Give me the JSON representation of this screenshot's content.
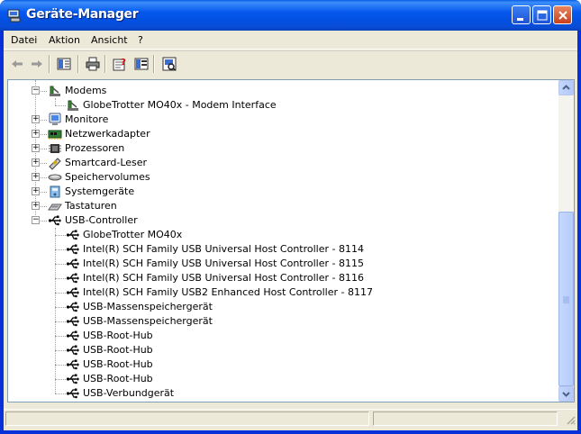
{
  "window": {
    "title": "Geräte-Manager",
    "titlebar_color": "#0558ee",
    "close_color": "#c8401c"
  },
  "menubar": {
    "items": [
      "Datei",
      "Aktion",
      "Ansicht",
      "?"
    ]
  },
  "toolbar": {
    "buttons": [
      "back-arrow-icon",
      "forward-arrow-icon",
      "console-tree-icon",
      "print-icon",
      "properties-icon",
      "view-icon",
      "scan-hardware-icon"
    ]
  },
  "tree": {
    "rows": [
      {
        "label": "Modems",
        "level": 0,
        "expanded": true,
        "icon": "modem-icon"
      },
      {
        "label": "GlobeTrotter MO40x - Modem Interface",
        "level": 1,
        "icon": "modem-icon"
      },
      {
        "label": "Monitore",
        "level": 0,
        "expanded": false,
        "icon": "monitor-icon"
      },
      {
        "label": "Netzwerkadapter",
        "level": 0,
        "expanded": false,
        "icon": "network-adapter-icon"
      },
      {
        "label": "Prozessoren",
        "level": 0,
        "expanded": false,
        "icon": "processor-icon"
      },
      {
        "label": "Smartcard-Leser",
        "level": 0,
        "expanded": false,
        "icon": "smartcard-reader-icon"
      },
      {
        "label": "Speichervolumes",
        "level": 0,
        "expanded": false,
        "icon": "storage-volume-icon"
      },
      {
        "label": "Systemgeräte",
        "level": 0,
        "expanded": false,
        "icon": "system-device-icon"
      },
      {
        "label": "Tastaturen",
        "level": 0,
        "expanded": false,
        "icon": "keyboard-icon"
      },
      {
        "label": "USB-Controller",
        "level": 0,
        "expanded": true,
        "icon": "usb-icon"
      },
      {
        "label": "GlobeTrotter MO40x",
        "level": 1,
        "icon": "usb-icon"
      },
      {
        "label": "Intel(R) SCH Family USB Universal Host Controller - 8114",
        "level": 1,
        "icon": "usb-icon"
      },
      {
        "label": "Intel(R) SCH Family USB Universal Host Controller - 8115",
        "level": 1,
        "icon": "usb-icon"
      },
      {
        "label": "Intel(R) SCH Family USB Universal Host Controller - 8116",
        "level": 1,
        "icon": "usb-icon"
      },
      {
        "label": "Intel(R) SCH Family USB2 Enhanced Host Controller - 8117",
        "level": 1,
        "icon": "usb-icon"
      },
      {
        "label": "USB-Massenspeichergerät",
        "level": 1,
        "icon": "usb-icon"
      },
      {
        "label": "USB-Massenspeichergerät",
        "level": 1,
        "icon": "usb-icon"
      },
      {
        "label": "USB-Root-Hub",
        "level": 1,
        "icon": "usb-icon"
      },
      {
        "label": "USB-Root-Hub",
        "level": 1,
        "icon": "usb-icon"
      },
      {
        "label": "USB-Root-Hub",
        "level": 1,
        "icon": "usb-icon"
      },
      {
        "label": "USB-Root-Hub",
        "level": 1,
        "icon": "usb-icon"
      },
      {
        "label": "USB-Verbundgerät",
        "level": 1,
        "icon": "usb-icon"
      }
    ]
  },
  "scrollbar": {
    "position_fraction": 1.0,
    "visible_fraction": 0.6
  },
  "statusbar": {
    "text": ""
  }
}
